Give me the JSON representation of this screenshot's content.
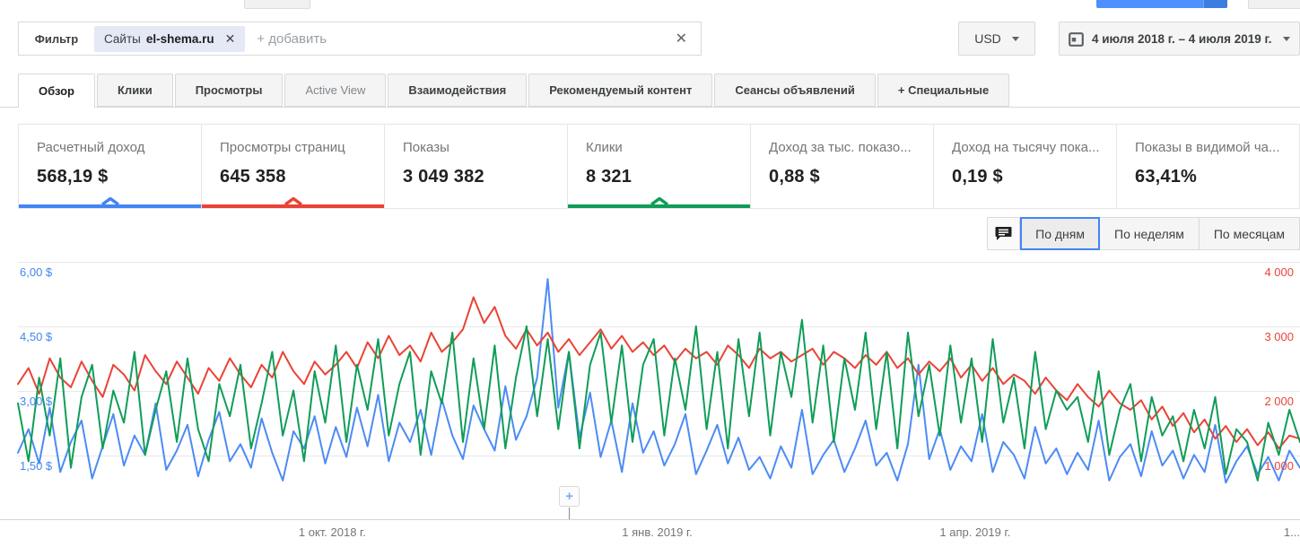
{
  "colors": {
    "blue": "#4285f4",
    "red": "#ea4335",
    "green": "#0f9d58"
  },
  "icons": {
    "chip_remove": "✕",
    "filter_clear": "✕",
    "plus_annotation": "+",
    "comment": "comment-bubble",
    "calendar": "calendar",
    "caret_down": "caret-down"
  },
  "filter": {
    "label": "Фильтр",
    "chip_prefix": "Сайты",
    "chip_site": "el-shema.ru",
    "add_placeholder": "+ добавить"
  },
  "toolbar": {
    "currency": "USD",
    "date_range": "4 июля 2018 г. – 4 июля 2019 г."
  },
  "tabs": [
    {
      "id": "obzor",
      "label": "Обзор",
      "active": true
    },
    {
      "id": "kliki",
      "label": "Клики"
    },
    {
      "id": "prosmotry",
      "label": "Просмотры"
    },
    {
      "id": "active-view",
      "label": "Active View",
      "muted": true
    },
    {
      "id": "vzaimodeystviya",
      "label": "Взаимодействия"
    },
    {
      "id": "rekomenduemy-kontent",
      "label": "Рекомендуемый контент"
    },
    {
      "id": "seansy-obyavleniy",
      "label": "Сеансы объявлений"
    },
    {
      "id": "spetsialnye",
      "label": "+  Специальные"
    }
  ],
  "cards": [
    {
      "id": "estimated-earnings",
      "label": "Расчетный доход",
      "value": "568,19 $",
      "accent": "#4285f4"
    },
    {
      "id": "page-views",
      "label": "Просмотры страниц",
      "value": "645 358",
      "accent": "#ea4335"
    },
    {
      "id": "impressions",
      "label": "Показы",
      "value": "3 049 382",
      "accent": null
    },
    {
      "id": "clicks",
      "label": "Клики",
      "value": "8 321",
      "accent": "#0f9d58"
    },
    {
      "id": "rpm",
      "label": "Доход за тыс. показо...",
      "value": "0,88 $",
      "accent": null
    },
    {
      "id": "impression-rpm",
      "label": "Доход на тысячу пока...",
      "value": "0,19 $",
      "accent": null
    },
    {
      "id": "viewability",
      "label": "Показы в видимой ча...",
      "value": "63,41%",
      "accent": null
    }
  ],
  "view_controls": {
    "selected": 0,
    "options": [
      {
        "id": "po-dnyam",
        "label": "По дням"
      },
      {
        "id": "po-nedelyam",
        "label": "По неделям"
      },
      {
        "id": "po-mesyatsam",
        "label": "По месяцам"
      }
    ]
  },
  "chart_data": {
    "type": "line",
    "x_unit": "day",
    "day_step": 3,
    "x_range_days": [
      0,
      363
    ],
    "grid": true,
    "legend": "none",
    "y_left": {
      "unit": "USD",
      "range": [
        0,
        6
      ],
      "color": "#4285f4",
      "ticks": [
        "6,00 $",
        "4,50 $",
        "3,00 $",
        "1,50 $"
      ]
    },
    "y_right": {
      "unit": "count",
      "range": [
        0,
        4000
      ],
      "color": "#ea4335",
      "ticks": [
        "4 000",
        "3 000",
        "2 000",
        "1 000"
      ]
    },
    "x_ticks": [
      {
        "label": "1 окт. 2018 г.",
        "day": 89,
        "align": "center"
      },
      {
        "label": "1 янв. 2019 г.",
        "day": 181,
        "align": "center"
      },
      {
        "label": "1 апр. 2019 г.",
        "day": 271,
        "align": "center"
      },
      {
        "label": "1...",
        "day": 363,
        "align": "end"
      }
    ],
    "annotation": {
      "symbol": "+",
      "day": 156
    },
    "series": [
      {
        "id": "estimated-earnings",
        "name": "Расчетный доход",
        "color": "#4c8bf5",
        "axis": "left",
        "max": 6,
        "values": [
          1.55,
          2.1,
          1.3,
          2.6,
          1.1,
          1.8,
          2.3,
          0.95,
          1.7,
          2.45,
          1.25,
          1.95,
          1.5,
          2.7,
          1.15,
          1.6,
          2.2,
          1.0,
          1.85,
          2.5,
          1.35,
          1.75,
          1.2,
          2.35,
          1.55,
          0.9,
          2.05,
          1.65,
          2.4,
          1.3,
          2.15,
          1.45,
          2.6,
          1.7,
          2.9,
          1.35,
          2.25,
          1.8,
          2.55,
          1.5,
          2.8,
          1.95,
          1.4,
          2.65,
          2.1,
          1.6,
          3.1,
          1.85,
          2.4,
          3.3,
          5.6,
          2.6,
          3.9,
          1.9,
          2.95,
          1.45,
          2.3,
          1.1,
          2.7,
          1.55,
          2.05,
          1.25,
          1.75,
          2.45,
          1.05,
          1.6,
          2.2,
          1.3,
          1.9,
          1.15,
          1.45,
          0.95,
          1.7,
          1.2,
          2.55,
          1.05,
          1.5,
          1.85,
          1.1,
          1.65,
          2.3,
          1.25,
          1.55,
          0.9,
          1.75,
          3.6,
          1.4,
          2.1,
          1.15,
          1.7,
          1.35,
          2.45,
          1.1,
          1.8,
          1.5,
          0.95,
          2.15,
          1.3,
          1.65,
          1.05,
          1.55,
          1.15,
          2.3,
          0.9,
          1.45,
          1.75,
          1.0,
          2.05,
          1.25,
          1.6,
          0.95,
          1.5,
          1.1,
          2.2,
          0.85,
          1.35,
          1.7,
          1.05,
          1.45,
          0.9,
          1.6,
          1.2
        ]
      },
      {
        "id": "page-views",
        "name": "Просмотры страниц",
        "color": "#ea4335",
        "axis": "right",
        "max": 4000,
        "values": [
          2100,
          2350,
          1950,
          2500,
          2200,
          2050,
          2450,
          2150,
          1900,
          2400,
          2250,
          2000,
          2550,
          2300,
          2100,
          2450,
          2200,
          1950,
          2350,
          2150,
          2500,
          2250,
          2050,
          2400,
          2200,
          2600,
          2300,
          2100,
          2450,
          2250,
          2400,
          2600,
          2350,
          2750,
          2500,
          2850,
          2550,
          2700,
          2450,
          2900,
          2600,
          2750,
          2950,
          3450,
          3050,
          3300,
          2850,
          2650,
          2950,
          2700,
          2900,
          2600,
          2800,
          2550,
          2750,
          2950,
          2650,
          2850,
          2600,
          2750,
          2550,
          2700,
          2450,
          2650,
          2500,
          2600,
          2400,
          2700,
          2550,
          2350,
          2650,
          2500,
          2600,
          2450,
          2550,
          2650,
          2400,
          2600,
          2500,
          2350,
          2550,
          2400,
          2600,
          2350,
          2500,
          2250,
          2450,
          2300,
          2500,
          2200,
          2400,
          2150,
          2350,
          2100,
          2250,
          2150,
          1950,
          2200,
          2000,
          1850,
          2100,
          1900,
          1750,
          2000,
          1800,
          1700,
          1850,
          1550,
          1750,
          1450,
          1650,
          1350,
          1550,
          1250,
          1450,
          1200,
          1400,
          1150,
          1350,
          1100,
          1300,
          1250
        ]
      },
      {
        "id": "clicks",
        "name": "Клики",
        "color": "#0f9d58",
        "axis": "hidden",
        "max": 40,
        "values": [
          18,
          9,
          22,
          13,
          25,
          8,
          19,
          24,
          11,
          20,
          15,
          26,
          10,
          17,
          23,
          12,
          25,
          14,
          9,
          21,
          16,
          24,
          11,
          18,
          26,
          13,
          20,
          9,
          23,
          15,
          27,
          12,
          24,
          17,
          28,
          13,
          21,
          26,
          10,
          23,
          18,
          29,
          12,
          25,
          14,
          27,
          11,
          22,
          30,
          16,
          28,
          14,
          26,
          11,
          24,
          29,
          15,
          27,
          12,
          24,
          28,
          13,
          25,
          17,
          30,
          14,
          26,
          11,
          28,
          16,
          29,
          13,
          26,
          19,
          31,
          15,
          27,
          12,
          25,
          17,
          29,
          14,
          26,
          11,
          29,
          16,
          24,
          13,
          27,
          15,
          25,
          12,
          28,
          15,
          22,
          11,
          26,
          14,
          20,
          17,
          19,
          12,
          23,
          10,
          17,
          21,
          9,
          19,
          13,
          16,
          9,
          17,
          11,
          19,
          7,
          14,
          12,
          6,
          15,
          10,
          17,
          12
        ]
      }
    ]
  }
}
